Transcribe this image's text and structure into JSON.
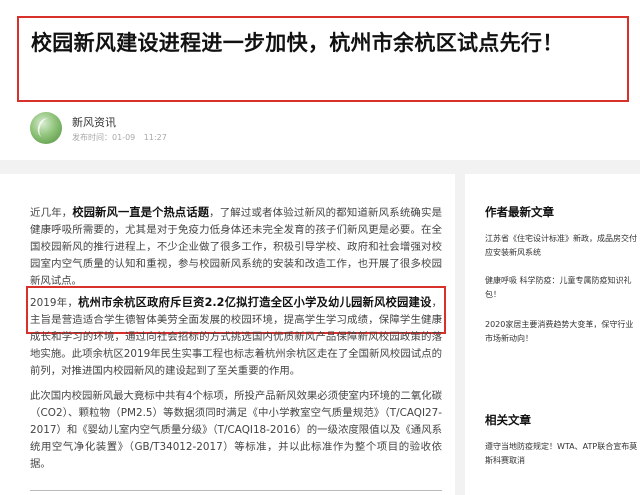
{
  "article": {
    "title": "校园新风建设进程进一步加快，杭州市余杭区试点先行！",
    "author": "新风资讯",
    "published_label": "发布时间：01-09",
    "published_time": "11:27",
    "paragraphs": [
      {
        "prefix": "近几年，",
        "bold": "校园新风一直是个热点话题",
        "rest": "，了解过或者体验过新风的都知道新风系统确实是健康呼吸所需要的，尤其是对于免疫力低身体还未完全发育的孩子们新风更是必要。在全国校园新风的推行进程上，不少企业做了很多工作，积极引导学校、政府和社会增强对校园室内空气质量的认知和重视，参与校园新风系统的安装和改造工作，也开展了很多校园新风试点。"
      },
      {
        "prefix": "2019年，",
        "bold": "杭州市余杭区政府斥巨资2.2亿拟打造全区小学及幼儿园新风校园建设",
        "rest": "，主旨是营造适合学生德智体美劳全面发展的校园环境，提高学生学习成绩，保障学生健康成长和学习的环境，通过向社会招标的方式挑选国内优质新风产品保障新风校园政策的落地实施。此项余杭区2019年民生实事工程也标志着杭州余杭区走在了全国新风校园试点的前列，对推进国内校园新风的建设起到了至关重要的作用。"
      },
      {
        "prefix": "",
        "bold": "",
        "rest": "此次国内校园新风最大竟标中共有4个标项，所投产品新风效果必须使室内环境的二氧化碳（CO2）、颗粒物（PM2.5）等数据须同时满足《中小学教室空气质量规范》（T/CAQI27-2017）和《婴幼儿室内空气质量分级》（T/CAQI18-2016）的一级浓度限值以及《通风系统用空气净化装置》（GB/T34012-2017）等标准，并以此标准作为整个项目的验收依据。"
      }
    ]
  },
  "sidebar": {
    "author_articles_title": "作者最新文章",
    "author_articles": [
      "江苏省《住宅设计标准》新政，成品房交付应安装新风系统",
      "健康呼吸 科学防疫：儿童专属防疫知识礼包！",
      "2020家居主要消费趋势大变革，保守行业市场新动向！"
    ],
    "related_title": "相关文章",
    "related": [
      "遵守当地防疫规定！WTA、ATP联合宣布莫斯科赛取消"
    ]
  },
  "colors": {
    "highlight_border": "#d8302b",
    "page_bg_gap": "#f2f2f2"
  }
}
